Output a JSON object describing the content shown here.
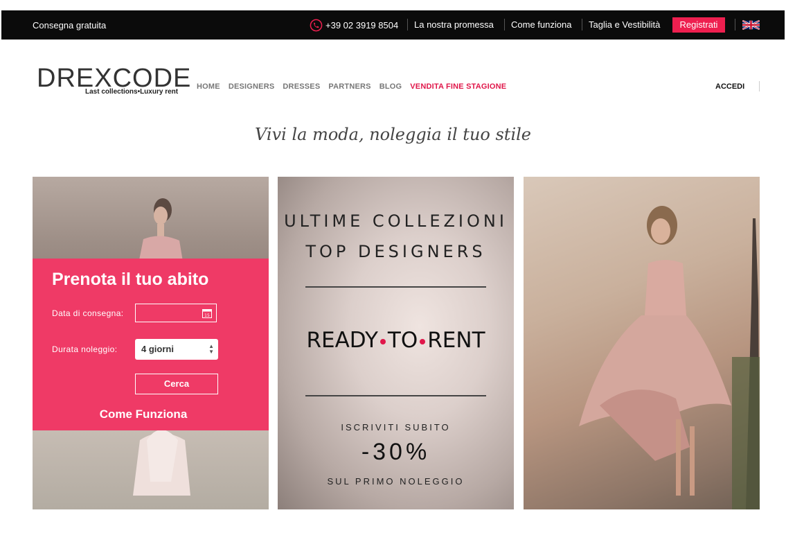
{
  "topbar": {
    "free_shipping": "Consegna gratuita",
    "phone": "+39 02 3919 8504",
    "links": [
      "La nostra promessa",
      "Come funziona",
      "Taglia e Vestibilità"
    ],
    "register": "Registrati",
    "flag_icon": "uk-flag-icon"
  },
  "header": {
    "logo_word": "DREXCODE",
    "logo_tagline": "Last collections•Luxury rent",
    "nav": [
      "HOME",
      "DESIGNERS",
      "DRESSES",
      "PARTNERS",
      "BLOG",
      "VENDITA FINE STAGIONE"
    ],
    "login": "ACCEDI"
  },
  "slogan": "Vivi la moda, noleggia il tuo stile",
  "booking": {
    "title": "Prenota il tuo abito",
    "date_label": "Data di consegna:",
    "date_value": "",
    "calendar_day": "15",
    "duration_label": "Durata noleggio:",
    "duration_value": "4 giorni",
    "search": "Cerca",
    "how": "Come Funziona"
  },
  "promo": {
    "line1": "ULTIME COLLEZIONI",
    "line2": "TOP DESIGNERS",
    "ready": "READY",
    "to": "TO",
    "rent": "RENT",
    "sub1": "ISCRIVITI SUBITO",
    "discount": "-30%",
    "sub2": "SUL PRIMO NOLEGGIO"
  },
  "colors": {
    "accent": "#ee1f4f",
    "topbar": "#0b0b0b",
    "booking_bg": "#ef3a66"
  }
}
